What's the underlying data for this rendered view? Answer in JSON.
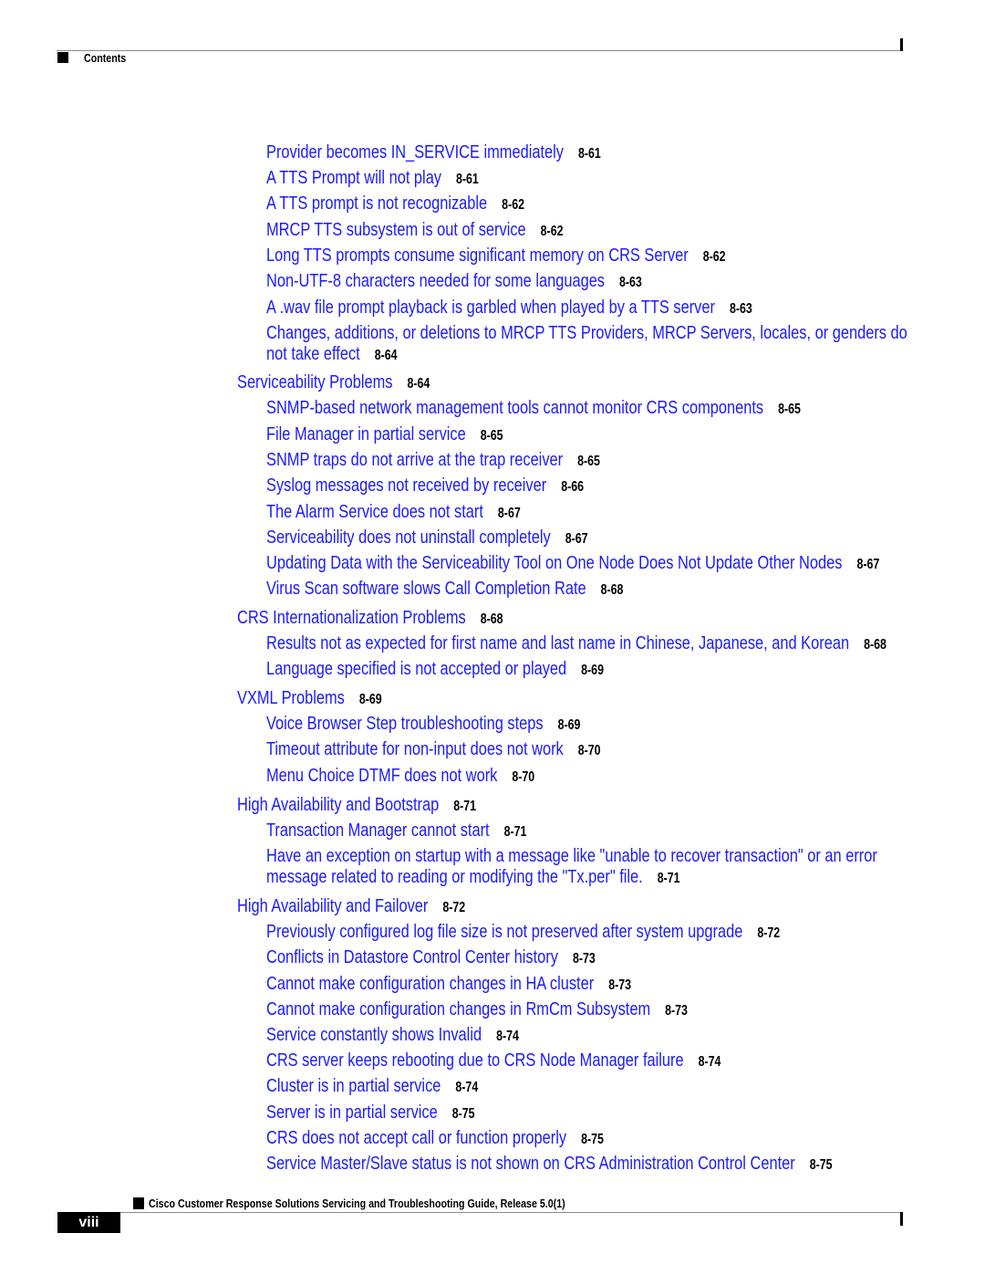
{
  "header": {
    "section_label": "Contents"
  },
  "toc": [
    {
      "level": 2,
      "title": "Provider becomes IN_SERVICE immediately",
      "page": "8-61"
    },
    {
      "level": 2,
      "title": "A TTS Prompt will not play",
      "page": "8-61"
    },
    {
      "level": 2,
      "title": "A TTS prompt is not recognizable",
      "page": "8-62"
    },
    {
      "level": 2,
      "title": "MRCP TTS subsystem is out of service",
      "page": "8-62"
    },
    {
      "level": 2,
      "title": "Long TTS prompts consume significant memory on CRS Server",
      "page": "8-62"
    },
    {
      "level": 2,
      "title": "Non-UTF-8 characters needed for some languages",
      "page": "8-63"
    },
    {
      "level": 2,
      "title": "A .wav file prompt playback is garbled when played by a TTS server",
      "page": "8-63"
    },
    {
      "level": 2,
      "title": "Changes, additions, or deletions to MRCP TTS Providers, MRCP Servers, locales, or genders do not take effect",
      "page": "8-64"
    },
    {
      "level": 1,
      "title": "Serviceability Problems",
      "page": "8-64"
    },
    {
      "level": 2,
      "title": "SNMP-based network management tools cannot monitor CRS components",
      "page": "8-65"
    },
    {
      "level": 2,
      "title": "File Manager in partial service",
      "page": "8-65"
    },
    {
      "level": 2,
      "title": "SNMP traps do not arrive at the trap receiver",
      "page": "8-65"
    },
    {
      "level": 2,
      "title": "Syslog messages not received by receiver",
      "page": "8-66"
    },
    {
      "level": 2,
      "title": "The Alarm Service does not start",
      "page": "8-67"
    },
    {
      "level": 2,
      "title": "Serviceability does not uninstall completely",
      "page": "8-67"
    },
    {
      "level": 2,
      "title": "Updating Data with the Serviceability Tool on One Node Does Not Update Other Nodes",
      "page": "8-67"
    },
    {
      "level": 2,
      "title": "Virus Scan software slows Call Completion Rate",
      "page": "8-68"
    },
    {
      "level": 1,
      "title": "CRS Internationalization Problems",
      "page": "8-68"
    },
    {
      "level": 2,
      "title": "Results not as expected for first name and last name in Chinese, Japanese, and Korean",
      "page": "8-68"
    },
    {
      "level": 2,
      "title": "Language specified is not accepted or played",
      "page": "8-69"
    },
    {
      "level": 1,
      "title": "VXML Problems",
      "page": "8-69"
    },
    {
      "level": 2,
      "title": "Voice Browser Step troubleshooting steps",
      "page": "8-69"
    },
    {
      "level": 2,
      "title": "Timeout attribute for non-input does not work",
      "page": "8-70"
    },
    {
      "level": 2,
      "title": "Menu Choice DTMF does not work",
      "page": "8-70"
    },
    {
      "level": 1,
      "title": "High Availability and Bootstrap",
      "page": "8-71"
    },
    {
      "level": 2,
      "title": "Transaction Manager cannot start",
      "page": "8-71"
    },
    {
      "level": 2,
      "title": "Have an exception on startup with a message like \"unable to recover transaction\" or an error message related to reading or modifying the \"Tx.per\" file.",
      "page": "8-71"
    },
    {
      "level": 1,
      "title": "High Availability and Failover",
      "page": "8-72"
    },
    {
      "level": 2,
      "title": "Previously configured log file size is not preserved after system upgrade",
      "page": "8-72"
    },
    {
      "level": 2,
      "title": "Conflicts in Datastore Control Center history",
      "page": "8-73"
    },
    {
      "level": 2,
      "title": "Cannot make configuration changes in HA cluster",
      "page": "8-73"
    },
    {
      "level": 2,
      "title": "Cannot make configuration changes in RmCm Subsystem",
      "page": "8-73"
    },
    {
      "level": 2,
      "title": "Service constantly shows Invalid",
      "page": "8-74"
    },
    {
      "level": 2,
      "title": "CRS server keeps rebooting due to CRS Node Manager failure",
      "page": "8-74"
    },
    {
      "level": 2,
      "title": "Cluster is in partial service",
      "page": "8-74"
    },
    {
      "level": 2,
      "title": "Server is in partial service",
      "page": "8-75"
    },
    {
      "level": 2,
      "title": "CRS does not accept call or function properly",
      "page": "8-75"
    },
    {
      "level": 2,
      "title": "Service Master/Slave status is not shown on CRS Administration Control Center",
      "page": "8-75"
    }
  ],
  "footer": {
    "book_title": "Cisco Customer Response Solutions Servicing and Troubleshooting Guide, Release 5.0(1)",
    "page_number": "viii"
  },
  "colors": {
    "link": "#1a1aff",
    "page_ref": "#000000"
  }
}
